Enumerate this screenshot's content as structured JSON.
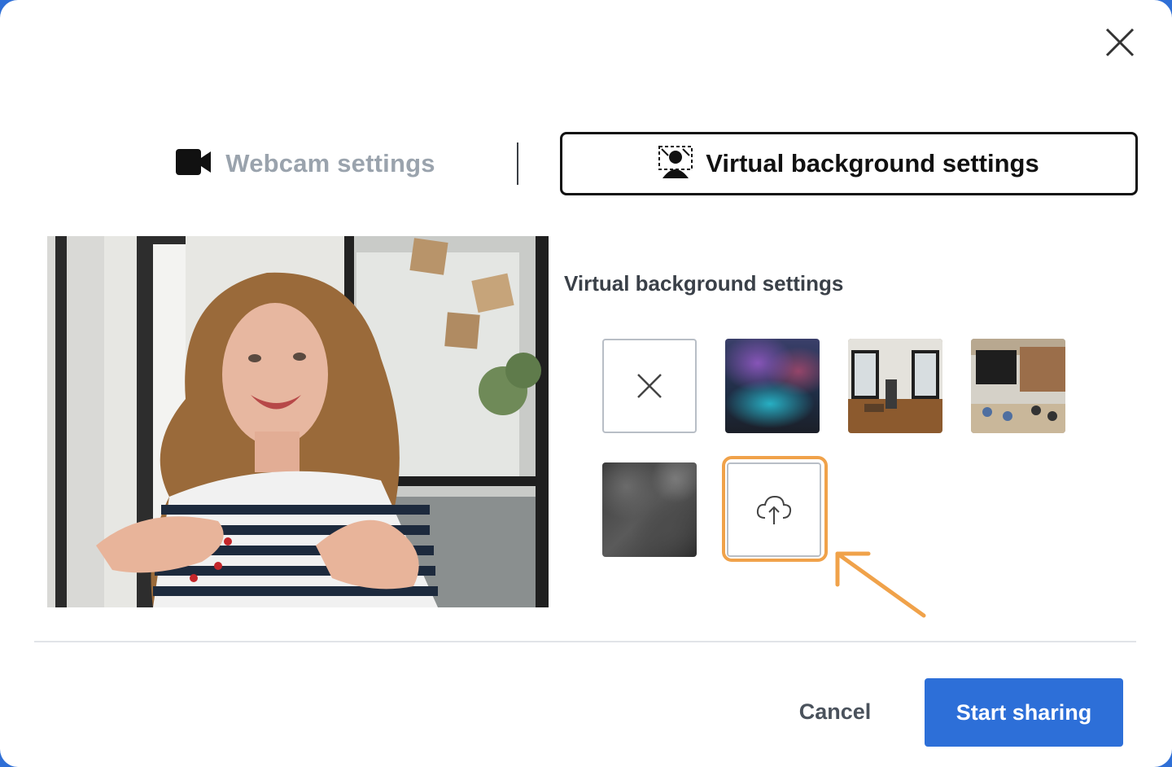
{
  "dialog": {
    "close_icon": "close-icon"
  },
  "tabs": [
    {
      "label": "Webcam settings",
      "icon": "video-camera-icon",
      "active": false
    },
    {
      "label": "Virtual background settings",
      "icon": "virtual-background-icon",
      "active": true
    }
  ],
  "section": {
    "title": "Virtual background settings"
  },
  "backgrounds": [
    {
      "type": "none",
      "icon": "x-icon"
    },
    {
      "type": "image",
      "description": "aurora-blur"
    },
    {
      "type": "image",
      "description": "office-interior"
    },
    {
      "type": "image",
      "description": "office-cafe"
    },
    {
      "type": "image",
      "description": "gray-marble"
    },
    {
      "type": "upload",
      "icon": "cloud-upload-icon"
    }
  ],
  "annotation": {
    "color": "#f0a24a"
  },
  "footer": {
    "cancel_label": "Cancel",
    "start_label": "Start sharing",
    "primary_color": "#2d6fd8"
  }
}
